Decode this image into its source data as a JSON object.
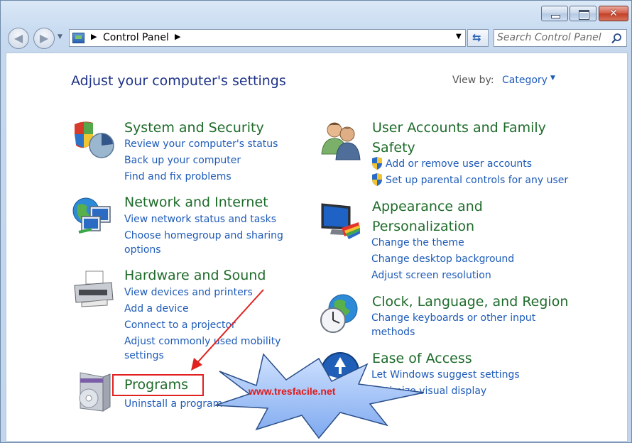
{
  "window": {
    "caption_buttons": [
      "minimize",
      "maximize",
      "close"
    ],
    "close_glyph": "✕"
  },
  "nav": {
    "back_glyph": "◀",
    "forward_glyph": "▶",
    "address_path": "Control Panel",
    "search_placeholder": "Search Control Panel"
  },
  "header": {
    "title": "Adjust your computer's settings",
    "view_by_label": "View by:",
    "view_by_value": "Category"
  },
  "categories": {
    "system": {
      "title": "System and Security",
      "links": [
        "Review your computer's status",
        "Back up your computer",
        "Find and fix problems"
      ]
    },
    "network": {
      "title": "Network and Internet",
      "links": [
        "View network status and tasks",
        "Choose homegroup and sharing",
        "options"
      ]
    },
    "hardware": {
      "title": "Hardware and Sound",
      "links": [
        "View devices and printers",
        "Add a device",
        "Connect to a projector",
        "Adjust commonly used mobility",
        "settings"
      ]
    },
    "programs": {
      "title": "Programs",
      "links": [
        "Uninstall a program"
      ]
    },
    "users": {
      "title_line1": "User Accounts and Family",
      "title_line2": "Safety",
      "links": [
        "Add or remove user accounts",
        "Set up parental controls for any user"
      ]
    },
    "appearance": {
      "title_line1": "Appearance and",
      "title_line2": "Personalization",
      "links": [
        "Change the theme",
        "Change desktop background",
        "Adjust screen resolution"
      ]
    },
    "clock": {
      "title": "Clock, Language, and Region",
      "links": [
        "Change keyboards or other input",
        "methods"
      ]
    },
    "ease": {
      "title": "Ease of Access",
      "links": [
        "Let Windows suggest settings",
        "Optimize visual display"
      ]
    }
  },
  "annotation": {
    "callout_text": "www.tresfacile.net",
    "highlight_color": "#e12020"
  },
  "icons": {
    "system": "shield-chart-icon",
    "network": "globe-monitors-icon",
    "hardware": "printer-icon",
    "programs": "software-box-icon",
    "users": "two-users-icon",
    "appearance": "monitor-palette-icon",
    "clock": "globe-clock-icon",
    "ease": "ease-of-access-icon"
  }
}
